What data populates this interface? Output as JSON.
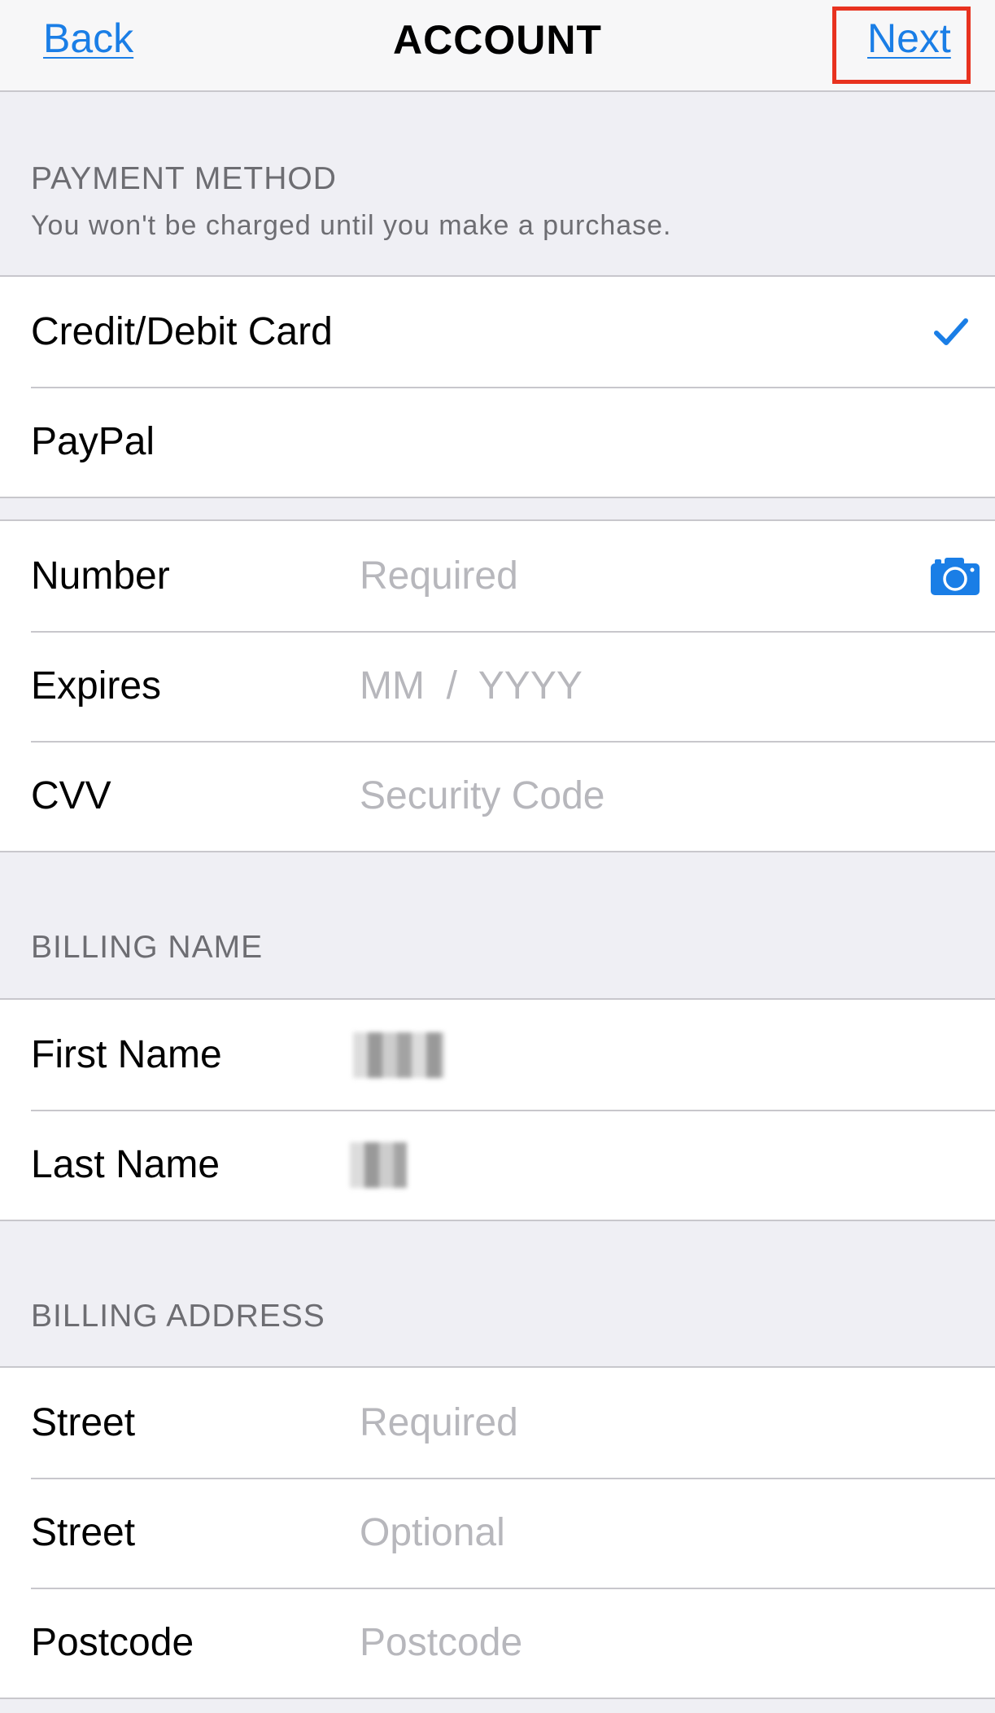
{
  "nav": {
    "back_label": "Back",
    "title": "ACCOUNT",
    "next_label": "Next"
  },
  "payment": {
    "header": "PAYMENT METHOD",
    "subheader": "You won't be charged until you make a purchase.",
    "options": [
      {
        "label": "Credit/Debit Card",
        "selected": true
      },
      {
        "label": "PayPal",
        "selected": false
      }
    ]
  },
  "card": {
    "number": {
      "label": "Number",
      "placeholder": "Required",
      "icon": "camera-icon"
    },
    "expires": {
      "label": "Expires",
      "placeholder": "MM  /  YYYY"
    },
    "cvv": {
      "label": "CVV",
      "placeholder": "Security Code"
    }
  },
  "billing_name": {
    "header": "BILLING NAME",
    "first": {
      "label": "First Name"
    },
    "last": {
      "label": "Last Name"
    }
  },
  "billing_address": {
    "header": "BILLING ADDRESS",
    "street1": {
      "label": "Street",
      "placeholder": "Required"
    },
    "street2": {
      "label": "Street",
      "placeholder": "Optional"
    },
    "postcode": {
      "label": "Postcode",
      "placeholder": "Postcode"
    }
  },
  "colors": {
    "accent": "#1a7ee6",
    "highlight_box": "#e8321f",
    "background": "#efeff4"
  }
}
